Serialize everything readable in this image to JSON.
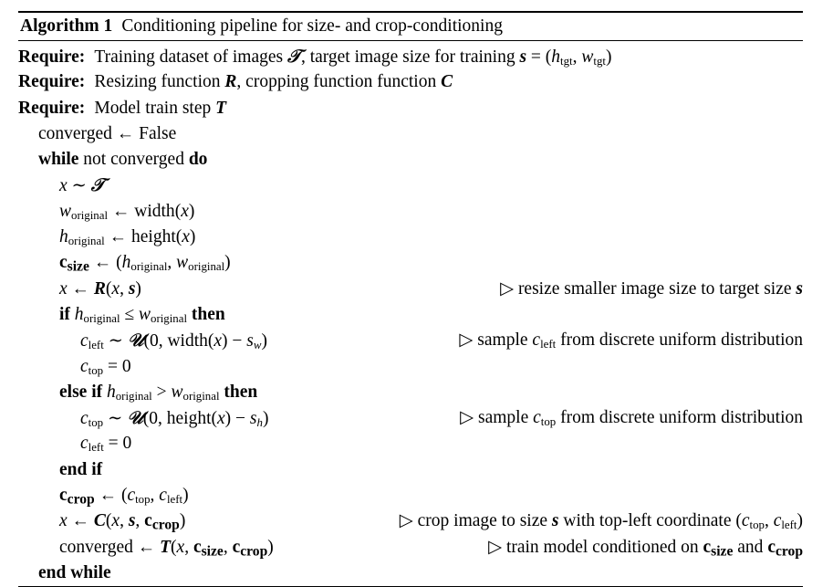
{
  "document": {
    "type": "algorithm-pseudocode-float",
    "title_prefix": "Algorithm 1",
    "title_text": "Conditioning pipeline for size- and crop-conditioning"
  },
  "symbols": {
    "gets": "←",
    "sim": "∼",
    "leq": "≤",
    "gt": ">",
    "eq": "=",
    "minus": "−",
    "comment_marker": "▷",
    "dataset": "𝒯",
    "uniform": "𝒰"
  },
  "lines": [
    {
      "id": "require-1",
      "indent": 0,
      "label": "Require:",
      "code_plain": "Require: Training dataset of images D, target image size for training s = (h_tgt, w_tgt)",
      "comment": ""
    },
    {
      "id": "require-2",
      "indent": 0,
      "label": "Require:",
      "code_plain": "Require: Resizing function R, cropping function function C",
      "comment": ""
    },
    {
      "id": "require-3",
      "indent": 0,
      "label": "Require:",
      "code_plain": "Require: Model train step T",
      "comment": ""
    },
    {
      "id": "converged-init",
      "indent": 1,
      "code_plain": "converged ← False",
      "comment": ""
    },
    {
      "id": "while-open",
      "indent": 1,
      "code_plain": "while not converged do",
      "comment": ""
    },
    {
      "id": "sample-x",
      "indent": 2,
      "code_plain": "x ∼ D",
      "comment": ""
    },
    {
      "id": "w-original",
      "indent": 2,
      "code_plain": "w_original ← width(x)",
      "comment": ""
    },
    {
      "id": "h-original",
      "indent": 2,
      "code_plain": "h_original ← height(x)",
      "comment": ""
    },
    {
      "id": "c-size",
      "indent": 2,
      "code_plain": "c_size ← (h_original, w_original)",
      "comment": ""
    },
    {
      "id": "resize-x",
      "indent": 2,
      "code_plain": "x ← R(x, s)",
      "comment": "▷ resize smaller image size to target size s"
    },
    {
      "id": "if-h-leq-w",
      "indent": 2,
      "code_plain": "if h_original ≤ w_original then",
      "comment": ""
    },
    {
      "id": "sample-cleft",
      "indent": 3,
      "code_plain": "c_left ∼ U(0, width(x) − s_w)",
      "comment": "▷ sample c_left from discrete uniform distribution"
    },
    {
      "id": "ctop-zero",
      "indent": 3,
      "code_plain": "c_top = 0",
      "comment": ""
    },
    {
      "id": "else-if-h-gt-w",
      "indent": 2,
      "code_plain": "else if h_original > w_original then",
      "comment": ""
    },
    {
      "id": "sample-ctop",
      "indent": 3,
      "code_plain": "c_top ∼ U(0, height(x) − s_h)",
      "comment": "▷ sample c_top from discrete uniform distribution"
    },
    {
      "id": "cleft-zero",
      "indent": 3,
      "code_plain": "c_left = 0",
      "comment": ""
    },
    {
      "id": "end-if",
      "indent": 2,
      "code_plain": "end if",
      "comment": ""
    },
    {
      "id": "c-crop",
      "indent": 2,
      "code_plain": "c_crop ← (c_top, c_left)",
      "comment": ""
    },
    {
      "id": "crop-x",
      "indent": 2,
      "code_plain": "x ← C(x, s, c_crop)",
      "comment": "▷ crop image to size s with top-left coordinate (c_top, c_left)"
    },
    {
      "id": "train-step",
      "indent": 2,
      "code_plain": "converged ← T(x, c_size, c_crop)",
      "comment": "▷ train model conditioned on c_size and c_crop"
    },
    {
      "id": "end-while",
      "indent": 1,
      "code_plain": "end while",
      "comment": ""
    }
  ],
  "keywords": {
    "require": "Require:",
    "while": "while",
    "not": "not",
    "do": "do",
    "if": "if",
    "then": "then",
    "else": "else",
    "end_if": "end if",
    "end_while": "end while",
    "false": "False",
    "converged": "converged",
    "width": "width",
    "height": "height"
  },
  "comments": {
    "resize": "resize smaller image size to target size",
    "sample_cleft": "sample",
    "sample_cleft_tail": "from discrete uniform distribution",
    "sample_ctop": "sample",
    "sample_ctop_tail": "from discrete uniform distribution",
    "crop": "crop image to size",
    "crop_tail": "with top-left coordinate",
    "train": "train model conditioned on",
    "train_and": "and"
  },
  "colors": {
    "text": "#000000",
    "background": "#ffffff",
    "rule": "#000000"
  }
}
